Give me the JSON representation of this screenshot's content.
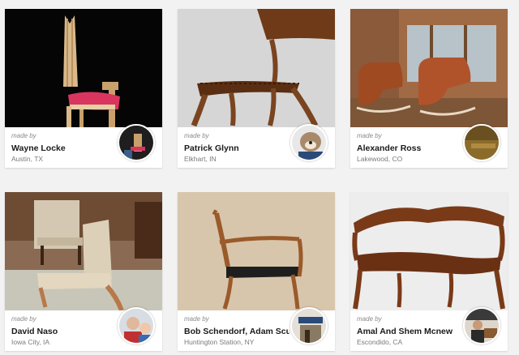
{
  "made_by_label": "made by",
  "cards": [
    {
      "name": "Wayne Locke",
      "location": "Austin, TX"
    },
    {
      "name": "Patrick Glynn",
      "location": "Elkhart, IN"
    },
    {
      "name": "Alexander Ross",
      "location": "Lakewood, CO"
    },
    {
      "name": "David Naso",
      "location": "Iowa City, IA"
    },
    {
      "name": "Bob Schendorf, Adam Scud...",
      "location": "Huntington Station, NY"
    },
    {
      "name": "Amal And Shem Mcnew",
      "location": "Escondido, CA"
    }
  ],
  "colors": {
    "background": "#f2f2f2",
    "card": "#ffffff",
    "name_text": "#1a1a1a",
    "meta_text": "#7a7a7a"
  }
}
